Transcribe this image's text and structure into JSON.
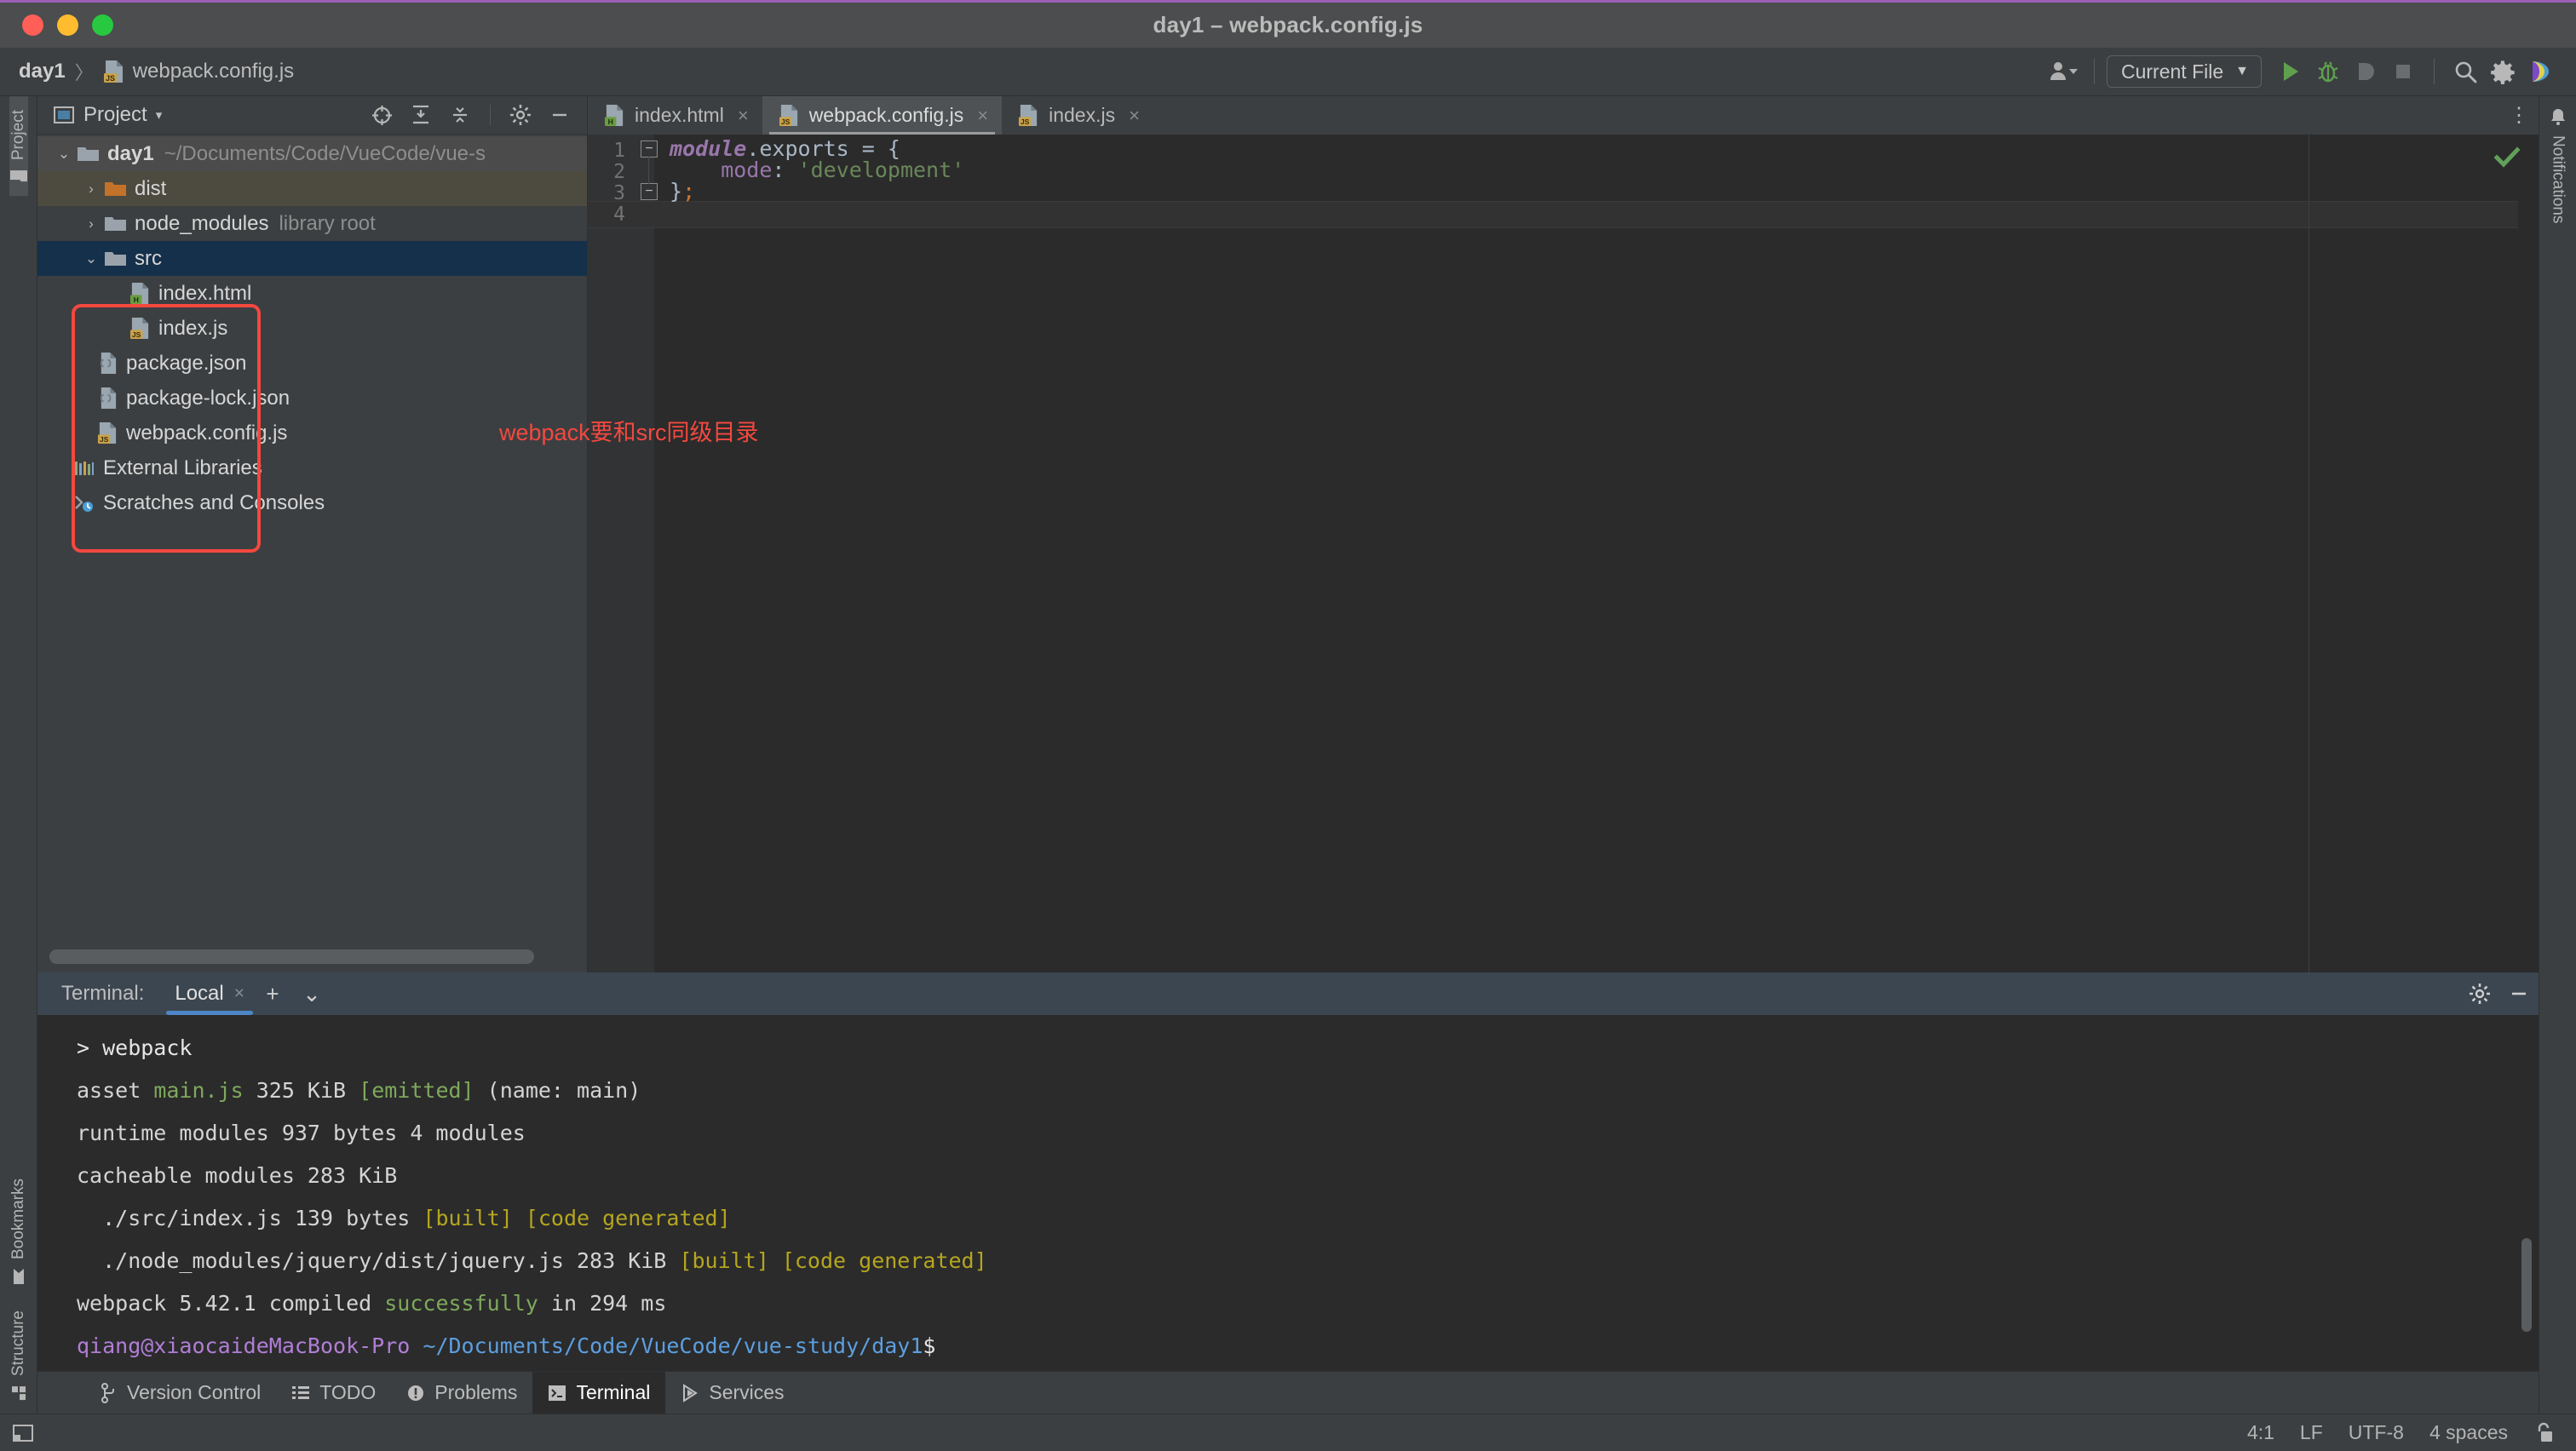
{
  "window": {
    "title": "day1 – webpack.config.js",
    "traffic_lights": [
      "close",
      "minimize",
      "zoom"
    ]
  },
  "navbar": {
    "breadcrumb": {
      "project": "day1",
      "separator": "〉",
      "file": "webpack.config.js"
    },
    "run_config": {
      "label": "Current File",
      "caret": "▼"
    },
    "buttons": [
      {
        "name": "user-accounts-button",
        "label": ""
      },
      {
        "name": "run-button",
        "label": ""
      },
      {
        "name": "debug-button",
        "label": ""
      },
      {
        "name": "run-with-coverage-button",
        "label": ""
      },
      {
        "name": "stop-button",
        "label": ""
      },
      {
        "name": "search-everywhere-button",
        "label": ""
      },
      {
        "name": "settings-button",
        "label": ""
      },
      {
        "name": "updates-button",
        "label": ""
      }
    ]
  },
  "stripes": {
    "left_top": [
      {
        "label": "Project",
        "icon": "project-folder-icon",
        "active": true
      }
    ],
    "left_bottom": [
      {
        "label": "Bookmarks",
        "icon": "bookmark-icon",
        "active": false
      },
      {
        "label": "Structure",
        "icon": "structure-icon",
        "active": false
      }
    ],
    "right": [
      {
        "label": "Notifications",
        "icon": "bell-icon",
        "active": false
      }
    ]
  },
  "project_panel": {
    "title": "Project",
    "caret": "▾",
    "actions": [
      {
        "name": "select-opened-file-icon",
        "label": ""
      },
      {
        "name": "expand-all-icon",
        "label": ""
      },
      {
        "name": "collapse-all-icon",
        "label": ""
      },
      {
        "name": "panel-settings-gear-icon",
        "label": ""
      },
      {
        "name": "hide-panel-icon",
        "label": ""
      }
    ],
    "tree": [
      {
        "label": "day1",
        "suffix": "~/Documents/Code/VueCode/vue-s",
        "indent": 0,
        "arrow": "⌄",
        "icon": "folder-module-icon",
        "bold": true,
        "state": "root"
      },
      {
        "label": "dist",
        "suffix": "",
        "indent": 1,
        "arrow": "›",
        "icon": "folder-excluded-icon",
        "bold": false,
        "state": "dist"
      },
      {
        "label": "node_modules",
        "suffix": "library root",
        "indent": 1,
        "arrow": "›",
        "icon": "folder-icon",
        "bold": false,
        "state": "none"
      },
      {
        "label": "src",
        "suffix": "",
        "indent": 1,
        "arrow": "⌄",
        "icon": "folder-icon",
        "bold": false,
        "state": "src-selected"
      },
      {
        "label": "index.html",
        "suffix": "",
        "indent": 2,
        "arrow": "",
        "icon": "html-file-icon",
        "bold": false,
        "state": "none"
      },
      {
        "label": "index.js",
        "suffix": "",
        "indent": 2,
        "arrow": "",
        "icon": "js-file-icon",
        "bold": false,
        "state": "none"
      },
      {
        "label": "package.json",
        "suffix": "",
        "indent": 1,
        "arrow": "",
        "icon": "json-file-icon",
        "bold": false,
        "state": "none"
      },
      {
        "label": "package-lock.json",
        "suffix": "",
        "indent": 1,
        "arrow": "",
        "icon": "json-file-icon",
        "bold": false,
        "state": "none"
      },
      {
        "label": "webpack.config.js",
        "suffix": "",
        "indent": 1,
        "arrow": "",
        "icon": "js-file-icon",
        "bold": false,
        "state": "none"
      },
      {
        "label": "External Libraries",
        "suffix": "",
        "indent": 0,
        "arrow": "",
        "icon": "libraries-icon",
        "bold": false,
        "state": "none"
      },
      {
        "label": "Scratches and Consoles",
        "suffix": "",
        "indent": 0,
        "arrow": "",
        "icon": "scratches-icon",
        "bold": false,
        "state": "none"
      }
    ]
  },
  "annotation": {
    "text": "webpack要和src同级目录",
    "color": "#f4483f"
  },
  "editor": {
    "tabs": [
      {
        "label": "index.html",
        "icon": "html-file-icon",
        "active": false,
        "close": "×"
      },
      {
        "label": "webpack.config.js",
        "icon": "js-file-icon",
        "active": true,
        "close": "×"
      },
      {
        "label": "index.js",
        "icon": "js-file-icon",
        "active": false,
        "close": "×"
      }
    ],
    "more_tabs": "⋮",
    "line_numbers": [
      "1",
      "2",
      "3",
      "4"
    ],
    "code": [
      {
        "tokens": [
          {
            "t": "module",
            "c": "k-module"
          },
          {
            "t": ".exports = {",
            "c": "k-plain"
          }
        ]
      },
      {
        "tokens": [
          {
            "t": "    mode",
            "c": "k-prop"
          },
          {
            "t": ": ",
            "c": "k-plain"
          },
          {
            "t": "'development'",
            "c": "k-str"
          }
        ]
      },
      {
        "tokens": [
          {
            "t": "}",
            "c": "k-plain"
          },
          {
            "t": ";",
            "c": "k-semi"
          }
        ]
      },
      {
        "tokens": []
      }
    ],
    "inspection_status": "ok-checkmark",
    "caret_line": 4
  },
  "terminal": {
    "label": "Terminal:",
    "tab": {
      "label": "Local",
      "close": "×"
    },
    "new_session": "+",
    "dropdown": "⌄",
    "settings_icon": "gear-icon",
    "minimize_icon": "minimize-icon",
    "lines": [
      [
        {
          "t": "> webpack",
          "c": "t-white"
        }
      ],
      [
        {
          "t": "",
          "c": ""
        }
      ],
      [
        {
          "t": "asset ",
          "c": ""
        },
        {
          "t": "main.js",
          "c": "t-green"
        },
        {
          "t": " 325 KiB ",
          "c": ""
        },
        {
          "t": "[emitted]",
          "c": "t-green"
        },
        {
          "t": " (name: main)",
          "c": ""
        }
      ],
      [
        {
          "t": "runtime modules 937 bytes 4 modules",
          "c": ""
        }
      ],
      [
        {
          "t": "cacheable modules 283 KiB",
          "c": ""
        }
      ],
      [
        {
          "t": "  ./src/index.js 139 bytes ",
          "c": ""
        },
        {
          "t": "[built] [code generated]",
          "c": "t-yellow"
        }
      ],
      [
        {
          "t": "  ./node_modules/jquery/dist/jquery.js 283 KiB ",
          "c": ""
        },
        {
          "t": "[built] [code generated]",
          "c": "t-yellow"
        }
      ],
      [
        {
          "t": "webpack 5.42.1 compiled ",
          "c": ""
        },
        {
          "t": "successfully",
          "c": "t-green"
        },
        {
          "t": " in 294 ms",
          "c": ""
        }
      ],
      [
        {
          "t": "qiang@xiaocaideMacBook-Pro",
          "c": "t-purple"
        },
        {
          "t": " ",
          "c": ""
        },
        {
          "t": "~/Documents/Code/VueCode/vue-study/day1",
          "c": "t-blue"
        },
        {
          "t": "$",
          "c": "t-white"
        }
      ]
    ]
  },
  "tool_windows": [
    {
      "label": "Version Control",
      "icon": "branch-icon",
      "active": false
    },
    {
      "label": "TODO",
      "icon": "todo-list-icon",
      "active": false
    },
    {
      "label": "Problems",
      "icon": "problems-icon",
      "active": false
    },
    {
      "label": "Terminal",
      "icon": "terminal-icon",
      "active": true
    },
    {
      "label": "Services",
      "icon": "services-icon",
      "active": false
    }
  ],
  "statusbar": {
    "left_icon": "show-tool-windows-icon",
    "caret_position": "4:1",
    "line_separator": "LF",
    "encoding": "UTF-8",
    "indent": "4 spaces",
    "lock_icon": "unlocked-padlock-icon"
  },
  "colors": {
    "accent_blue": "#4e86c7",
    "selection_blue": "#15304a",
    "annotation_red": "#f4483f",
    "string_green": "#6a8759",
    "keyword_purple": "#9876aa",
    "terminal_green": "#7ea95c",
    "terminal_yellow": "#b5a61f"
  }
}
